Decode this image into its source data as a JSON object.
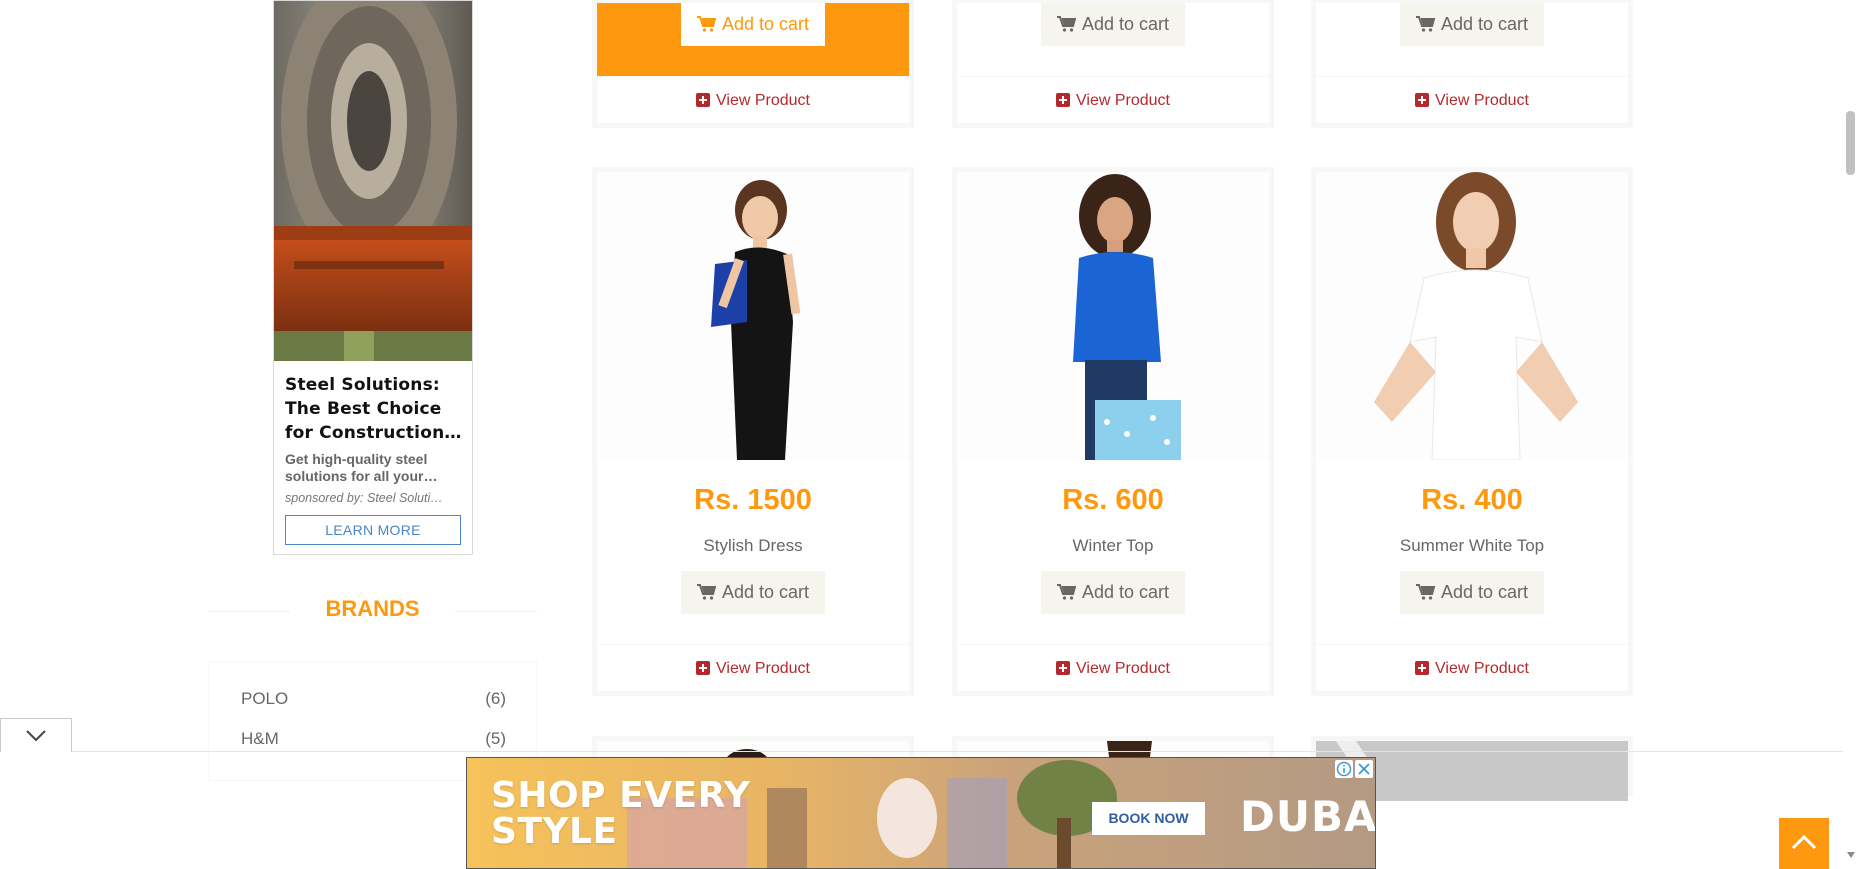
{
  "sidebar_ad": {
    "title": "Steel Solutions: The Best Choice for Construction…",
    "description": "Get high-quality steel solutions for all your…",
    "sponsor": "sponsored by: Steel Soluti…",
    "cta": "LEARN MORE"
  },
  "brands": {
    "title": "BRANDS",
    "items": [
      {
        "name": "POLO",
        "count": "(6)"
      },
      {
        "name": "H&M",
        "count": "(5)"
      }
    ]
  },
  "products_top_row": [
    {
      "add_to_cart": "Add to cart",
      "view": "View Product",
      "highlighted": true
    },
    {
      "add_to_cart": "Add to cart",
      "view": "View Product",
      "highlighted": false
    },
    {
      "add_to_cart": "Add to cart",
      "view": "View Product",
      "highlighted": false
    }
  ],
  "products": [
    {
      "price": "Rs. 1500",
      "name": "Stylish Dress",
      "add_to_cart": "Add to cart",
      "view": "View Product"
    },
    {
      "price": "Rs. 600",
      "name": "Winter Top",
      "add_to_cart": "Add to cart",
      "view": "View Product"
    },
    {
      "price": "Rs. 400",
      "name": "Summer White Top",
      "add_to_cart": "Add to cart",
      "view": "View Product"
    }
  ],
  "banner_ad": {
    "headline_line1": "SHOP EVERY",
    "headline_line2": "STYLE",
    "cta": "BOOK NOW",
    "brand": "DUBAI"
  },
  "colors": {
    "accent": "#FE980F",
    "link_red": "#B4292D",
    "text": "#696763",
    "card_border": "#F7F7F5"
  },
  "icons": [
    "cart-icon",
    "plus-square-icon",
    "chevron-down-icon",
    "chevron-up-icon",
    "ad-info-icon",
    "close-icon"
  ]
}
